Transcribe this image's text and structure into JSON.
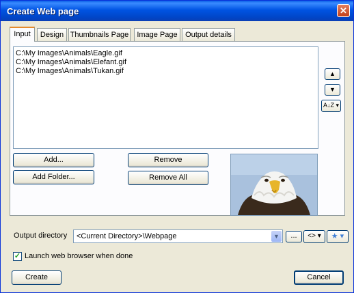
{
  "window": {
    "title": "Create Web page",
    "close_label": "✕"
  },
  "tabs": [
    {
      "label": "Input",
      "active": true
    },
    {
      "label": "Design"
    },
    {
      "label": "Thumbnails Page"
    },
    {
      "label": "Image Page"
    },
    {
      "label": "Output details"
    }
  ],
  "files": [
    "C:\\My Images\\Animals\\Eagle.gif",
    "C:\\My Images\\Animals\\Elefant.gif",
    "C:\\My Images\\Animals\\Tukan.gif"
  ],
  "buttons": {
    "add": "Add...",
    "add_folder": "Add Folder...",
    "remove": "Remove",
    "remove_all": "Remove All",
    "create": "Create",
    "cancel": "Cancel",
    "browse": "...",
    "move_up": "▲",
    "move_down": "▼",
    "sort": "A↓Z ▾",
    "code": "<> ▾",
    "favorite": "★ ▾"
  },
  "output": {
    "label": "Output directory",
    "value": "<Current Directory>\\Webpage"
  },
  "launch": {
    "label": "Launch web browser when done",
    "checked": true
  }
}
